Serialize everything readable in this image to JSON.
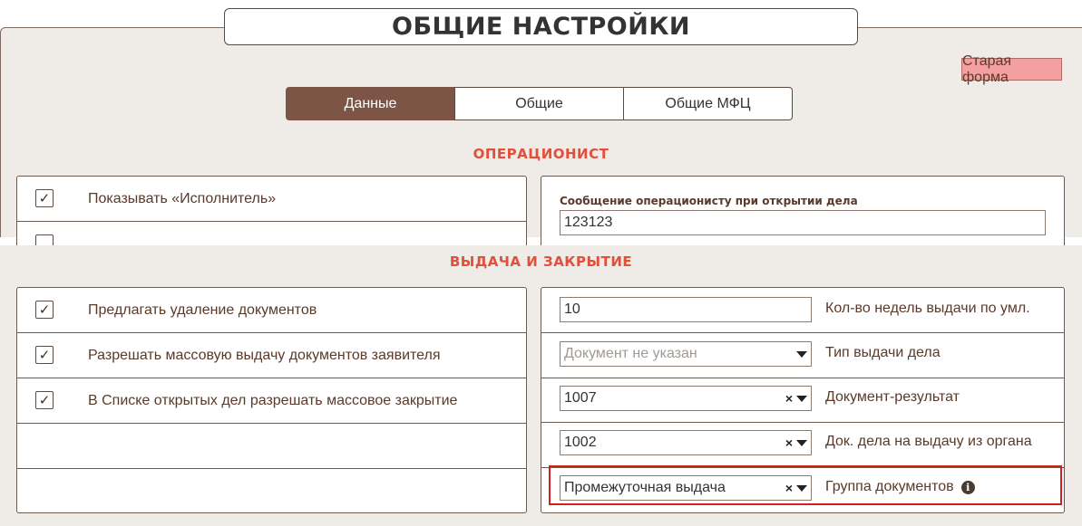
{
  "header": {
    "title": "ОБЩИЕ НАСТРОЙКИ",
    "old_form_label": "Старая форма"
  },
  "tabs": [
    {
      "label": "Данные",
      "active": true
    },
    {
      "label": "Общие",
      "active": false
    },
    {
      "label": "Общие МФЦ",
      "active": false
    }
  ],
  "operator": {
    "section_title": "ОПЕРАЦИОНИСТ",
    "checkbox_rows": [
      {
        "label": "Показывать «Исполнитель»",
        "checked": true
      }
    ],
    "message_field": {
      "label": "Сообщение операционисту при открытии дела",
      "value": "123123"
    }
  },
  "issue": {
    "section_title": "ВЫДАЧА И ЗАКРЫТИЕ",
    "checkbox_rows": [
      {
        "label": "Предлагать удаление документов",
        "checked": true
      },
      {
        "label": "Разрешать массовую выдачу документов заявителя",
        "checked": true
      },
      {
        "label": "В Списке открытых дел разрешать массовое закрытие",
        "checked": true
      }
    ],
    "fields": [
      {
        "value": "10",
        "label": "Кол-во недель выдачи по умл."
      },
      {
        "placeholder": "Документ не указан",
        "label": "Тип выдачи дела"
      },
      {
        "value": "1007",
        "label": "Документ-результат"
      },
      {
        "value": "1002",
        "label": "Док. дела на выдачу из органа"
      },
      {
        "value": "Промежуточная выдача",
        "label": "Группа документов"
      }
    ],
    "check_mark": "✓",
    "clear_mark": "×",
    "info_mark": "i"
  },
  "colors": {
    "accent": "#7d5547",
    "section_title": "#e0503a",
    "old_form_bg": "#f4a0a0",
    "highlight": "#d02020"
  }
}
